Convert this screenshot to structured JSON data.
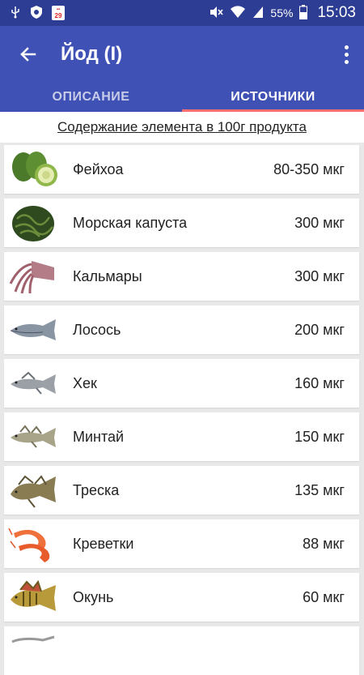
{
  "status_bar": {
    "battery": "55%",
    "time": "15:03",
    "calendar_badge": "29"
  },
  "toolbar": {
    "title": "Йод (I)"
  },
  "tabs": [
    {
      "label": "ОПИСАНИЕ",
      "active": false
    },
    {
      "label": "ИСТОЧНИКИ",
      "active": true
    }
  ],
  "content_header": "Содержание элемента в 100г продукта",
  "items": [
    {
      "name": "Фейхоа",
      "amount": "80-350 мкг",
      "icon": "feijoa-image"
    },
    {
      "name": "Морская капуста",
      "amount": "300 мкг",
      "icon": "seaweed-image"
    },
    {
      "name": "Кальмары",
      "amount": "300 мкг",
      "icon": "squid-image"
    },
    {
      "name": "Лосось",
      "amount": "200 мкг",
      "icon": "salmon-image"
    },
    {
      "name": "Хек",
      "amount": "160 мкг",
      "icon": "hake-image"
    },
    {
      "name": "Минтай",
      "amount": "150 мкг",
      "icon": "pollock-image"
    },
    {
      "name": "Треска",
      "amount": "135 мкг",
      "icon": "cod-image"
    },
    {
      "name": "Креветки",
      "amount": "88 мкг",
      "icon": "shrimp-image"
    },
    {
      "name": "Окунь",
      "amount": "60 мкг",
      "icon": "perch-image"
    }
  ],
  "colors": {
    "primary": "#3f51b5",
    "status_bar": "#2d3d93",
    "tab_indicator": "#ff6f6f"
  }
}
